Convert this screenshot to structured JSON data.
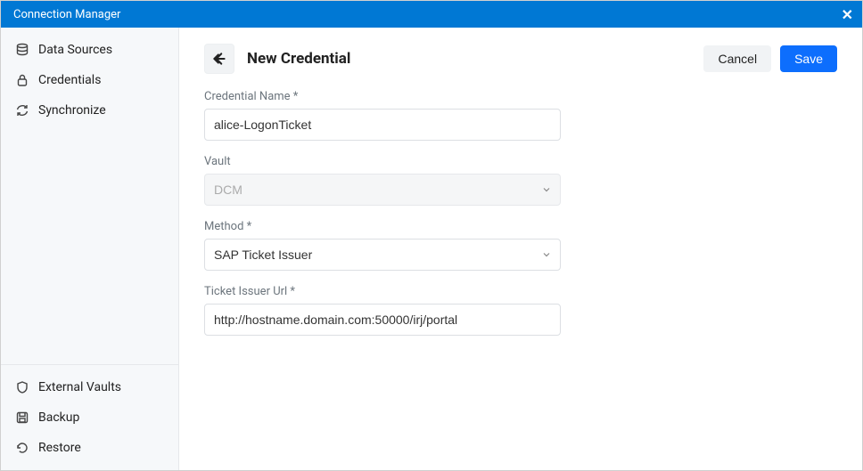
{
  "window": {
    "title": "Connection Manager"
  },
  "sidebar": {
    "top": [
      {
        "label": "Data Sources",
        "icon": "database"
      },
      {
        "label": "Credentials",
        "icon": "lock"
      },
      {
        "label": "Synchronize",
        "icon": "sync"
      }
    ],
    "bottom": [
      {
        "label": "External Vaults",
        "icon": "shield"
      },
      {
        "label": "Backup",
        "icon": "save"
      },
      {
        "label": "Restore",
        "icon": "restore"
      }
    ]
  },
  "header": {
    "title": "New Credential",
    "cancel": "Cancel",
    "save": "Save"
  },
  "form": {
    "credential_name": {
      "label": "Credential Name *",
      "value": "alice-LogonTicket"
    },
    "vault": {
      "label": "Vault",
      "value": "DCM",
      "disabled": true
    },
    "method": {
      "label": "Method *",
      "value": "SAP Ticket Issuer"
    },
    "ticket_url": {
      "label": "Ticket Issuer Url *",
      "value": "http://hostname.domain.com:50000/irj/portal"
    }
  }
}
